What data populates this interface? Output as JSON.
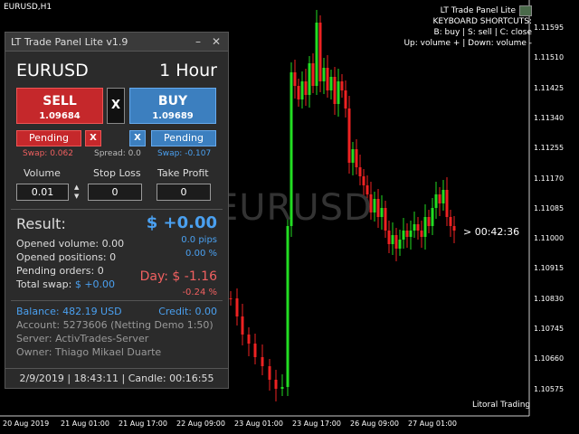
{
  "chart": {
    "title": "EURUSD,H1",
    "watermark": "EURUSD",
    "countdown": "> 00:42:36",
    "brand": "Litoral Trading",
    "info": {
      "title": "LT Trade Panel Lite",
      "shortcuts_title": "KEYBOARD SHORTCUTS:",
      "line1": "B: buy | S: sell | C: close",
      "line2": "Up: volume + | Down: volume -"
    },
    "price_labels": [
      "1.11595",
      "1.11510",
      "1.11425",
      "1.11340",
      "1.11255",
      "1.11170",
      "1.11085",
      "1.11000",
      "1.10915",
      "1.10830",
      "1.10745",
      "1.10660",
      "1.10575"
    ],
    "time_labels": [
      "20 Aug 2019",
      "21 Aug 01:00",
      "21 Aug 17:00",
      "22 Aug 09:00",
      "23 Aug 01:00",
      "23 Aug 17:00",
      "26 Aug 09:00",
      "27 Aug 01:00"
    ],
    "colors": {
      "bull": "#22dd22",
      "bear": "#ee2222",
      "background": "#000000"
    }
  },
  "panel": {
    "title": "LT Trade Panel Lite v1.9",
    "minimize_icon": "–",
    "close_icon": "✕",
    "symbol": "EURUSD",
    "timeframe": "1 Hour",
    "sell": {
      "label": "SELL",
      "price": "1.09684"
    },
    "buy": {
      "label": "BUY",
      "price": "1.09689"
    },
    "close_all": "X",
    "pending_label": "Pending",
    "pending_x": "X",
    "swap_sell": "Swap: 0.062",
    "spread": "Spread: 0.0",
    "swap_buy": "Swap: -0.107",
    "volume_label": "Volume",
    "stoploss_label": "Stop Loss",
    "takeprofit_label": "Take Profit",
    "volume_value": "0.01",
    "stoploss_value": "0",
    "takeprofit_value": "0",
    "stepper_up": "▲",
    "stepper_down": "▼",
    "result_label": "Result:",
    "result_value": "$ +0.00",
    "result_pips": "0.0 pips",
    "result_pct": "0.00 %",
    "opened_volume": "Opened volume: 0.00",
    "opened_positions": "Opened positions: 0",
    "pending_orders": "Pending orders: 0",
    "total_swap_label": "Total swap:",
    "total_swap_value": "$ +0.00",
    "day_value": "Day: $ -1.16",
    "day_pct": "-0.24 %",
    "balance": "Balance: 482.19 USD",
    "credit": "Credit: 0.00",
    "account": "Account: 5273606 (Netting Demo 1:50)",
    "server": "Server: ActivTrades-Server",
    "owner": "Owner: Thiago Mikael Duarte",
    "footer": "2/9/2019 | 18:43:11 | Candle: 00:16:55"
  }
}
